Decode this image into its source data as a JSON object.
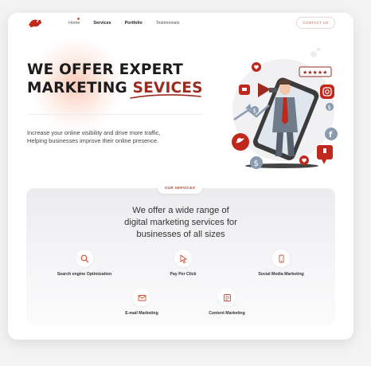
{
  "nav": {
    "items": [
      {
        "label": "Home",
        "active": false
      },
      {
        "label": "Services",
        "active": true
      },
      {
        "label": "Portfolio",
        "active": true
      },
      {
        "label": "Testimonials",
        "active": false
      }
    ],
    "contact_label": "CONTACT US"
  },
  "hero": {
    "title_line1": "WE OFFER EXPERT",
    "title_line2_a": "MARKETING ",
    "title_line2_b": "SEVICES",
    "subtitle_line1": "Increase your online visibility and drive more traffic,",
    "subtitle_line2": "Helping businesses improve their online presence."
  },
  "services": {
    "tag": "OUR SERVICES",
    "title_line1": "We offer a wide range of",
    "title_line2": "digital marketing services for",
    "title_line3": "businesses of all sizes",
    "items": [
      {
        "label": "Search engine Optimization",
        "icon": "search-icon"
      },
      {
        "label": "Pay Per Click",
        "icon": "cursor-icon"
      },
      {
        "label": "Social Media Marketing",
        "icon": "phone-icon"
      },
      {
        "label": "E-mail Marketing",
        "icon": "mail-icon"
      },
      {
        "label": "Content Marketing",
        "icon": "content-icon"
      }
    ]
  },
  "colors": {
    "accent": "#9b2b1f",
    "brand": "#e05a2b"
  }
}
